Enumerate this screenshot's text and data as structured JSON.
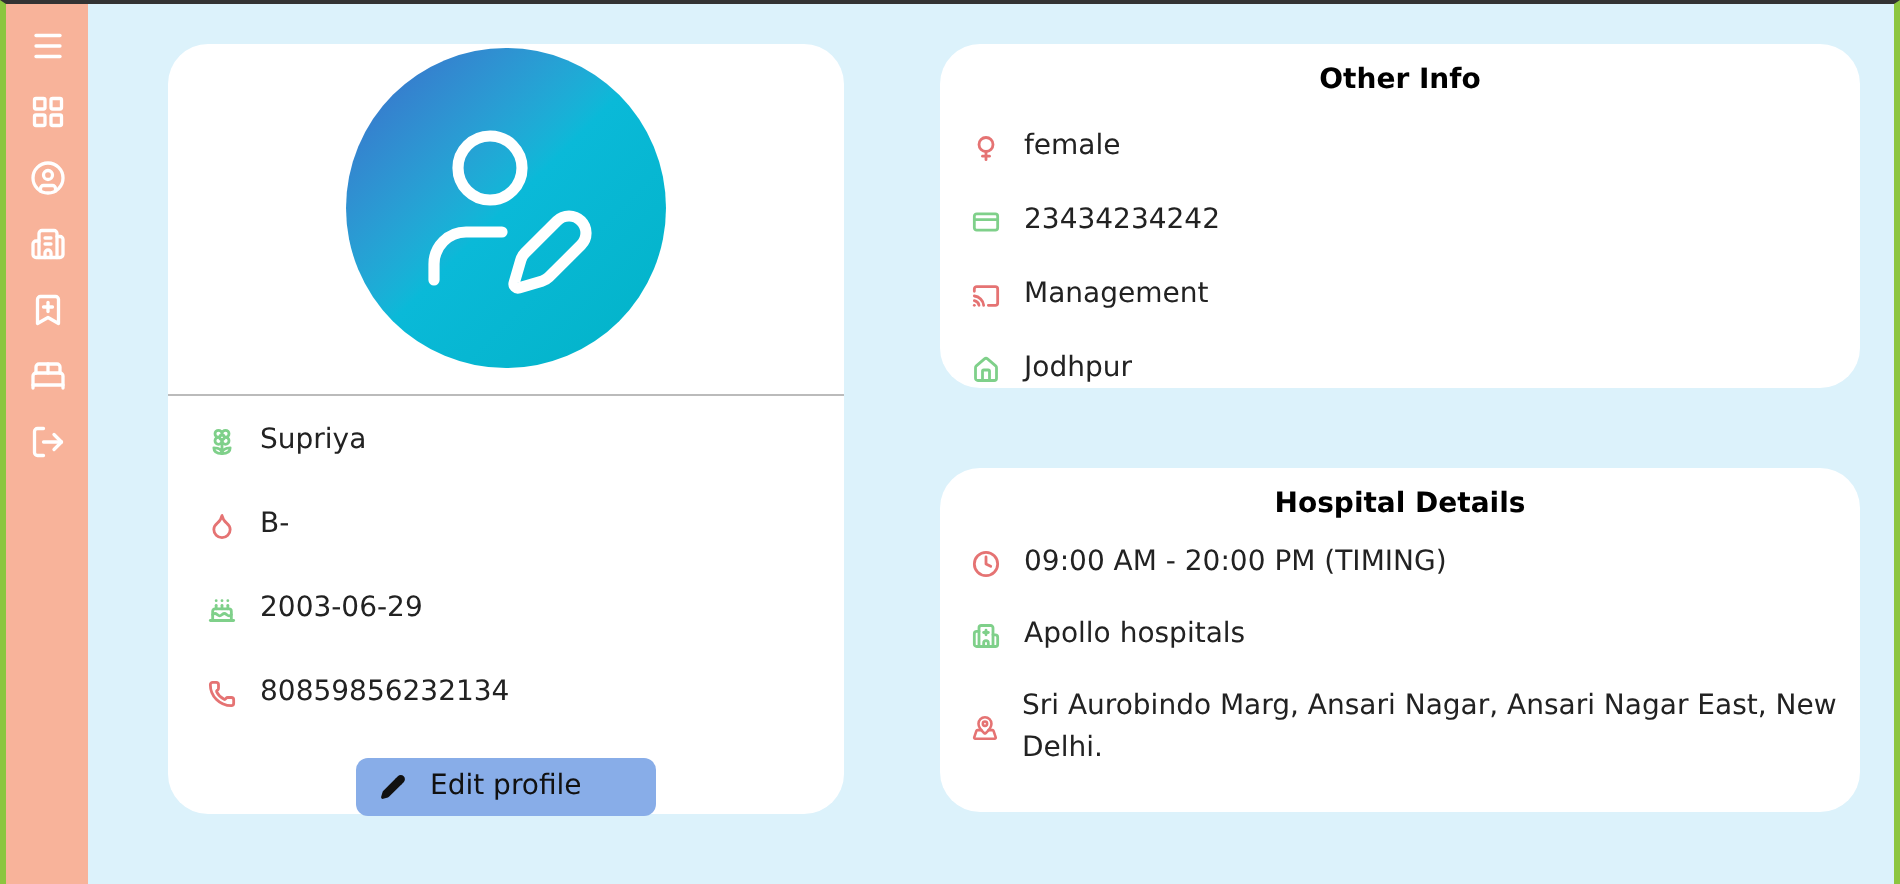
{
  "profile": {
    "details": [
      "Supriya",
      "B-",
      "2003-06-29",
      "80859856232134"
    ],
    "edit_button": "Edit profile"
  },
  "other_info": {
    "title": "Other Info",
    "items": [
      "female",
      "23434234242",
      "Management",
      "Jodhpur"
    ]
  },
  "hospital_details": {
    "title": "Hospital Details",
    "items": [
      "09:00 AM - 20:00 PM (TIMING)",
      "Apollo hospitals",
      "Sri Aurobindo Marg, Ansari Nagar, Ansari Nagar East, New Delhi."
    ]
  }
}
